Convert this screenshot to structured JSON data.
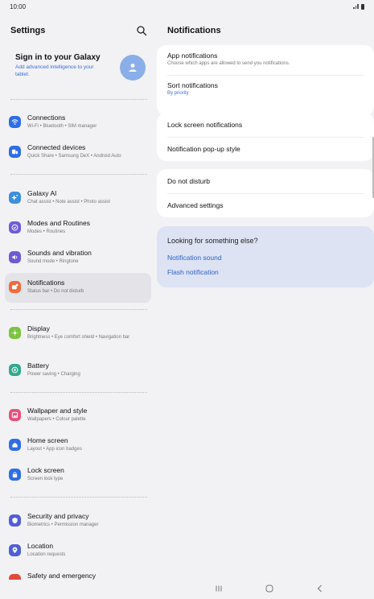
{
  "status": {
    "time": "10:00"
  },
  "left": {
    "title": "Settings",
    "account": {
      "title": "Sign in to your Galaxy",
      "subtitle": "Add advanced intelligence to your tablet."
    },
    "items": [
      {
        "title": "Connections",
        "sub": "Wi-Fi  •  Bluetooth  •  SIM manager",
        "color": "#2e6de6",
        "icon": "wifi-icon"
      },
      {
        "title": "Connected devices",
        "sub": "Quick Share  •  Samsung DeX  •  Android Auto",
        "color": "#2e6de6",
        "icon": "devices-icon"
      },
      {
        "title": "Galaxy AI",
        "sub": "Chat assist  •  Note assist  •  Photo assist",
        "color": "#3d8fd9",
        "icon": "sparkle-icon"
      },
      {
        "title": "Modes and Routines",
        "sub": "Modes  •  Routines",
        "color": "#6e5bd4",
        "icon": "check-circle-icon"
      },
      {
        "title": "Sounds and vibration",
        "sub": "Sound mode  •  Ringtone",
        "color": "#6e5bd4",
        "icon": "speaker-icon"
      },
      {
        "title": "Notifications",
        "sub": "Status bar  •  Do not disturb",
        "color": "#f06a3c",
        "icon": "notification-icon"
      },
      {
        "title": "Display",
        "sub": "Brightness  •  Eye comfort shield  •  Navigation bar",
        "color": "#7bc43e",
        "icon": "sun-icon"
      },
      {
        "title": "Battery",
        "sub": "Power saving  •  Charging",
        "color": "#2fa88d",
        "icon": "battery-icon"
      },
      {
        "title": "Wallpaper and style",
        "sub": "Wallpapers  •  Colour palette",
        "color": "#e8507a",
        "icon": "wallpaper-icon"
      },
      {
        "title": "Home screen",
        "sub": "Layout  •  App icon badges",
        "color": "#2e6de6",
        "icon": "home-icon"
      },
      {
        "title": "Lock screen",
        "sub": "Screen lock type",
        "color": "#2e6de6",
        "icon": "lock-icon"
      },
      {
        "title": "Security and privacy",
        "sub": "Biometrics  •  Permission manager",
        "color": "#4f5fd6",
        "icon": "shield-icon"
      },
      {
        "title": "Location",
        "sub": "Location requests",
        "color": "#4f5fd6",
        "icon": "location-pin-icon"
      },
      {
        "title": "Safety and emergency",
        "sub": "",
        "color": "#e24a3b",
        "icon": "emergency-icon"
      }
    ]
  },
  "right": {
    "title": "Notifications",
    "card1": {
      "app_notifications": {
        "title": "App notifications",
        "sub": "Choose which apps are allowed to send you notifications."
      },
      "sort_notifications": {
        "title": "Sort notifications",
        "sub": "By priority"
      }
    },
    "card2": {
      "lock_screen": "Lock screen notifications",
      "popup_style": "Notification pop-up style"
    },
    "card3": {
      "dnd": "Do not disturb",
      "advanced": "Advanced settings"
    },
    "suggest": {
      "title": "Looking for something else?",
      "links": [
        "Notification sound",
        "Flash notification"
      ]
    }
  }
}
